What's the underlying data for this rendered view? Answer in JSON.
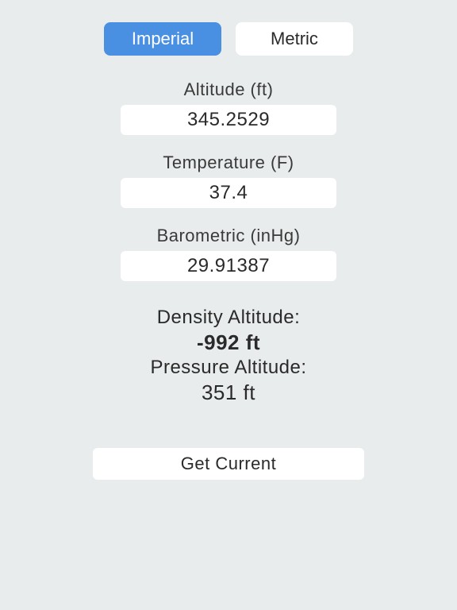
{
  "tabs": {
    "imperial": "Imperial",
    "metric": "Metric"
  },
  "fields": {
    "altitude": {
      "label": "Altitude (ft)",
      "value": "345.2529"
    },
    "temperature": {
      "label": "Temperature (F)",
      "value": "37.4"
    },
    "barometric": {
      "label": "Barometric (inHg)",
      "value": "29.91387"
    }
  },
  "results": {
    "density_label": "Density Altitude:",
    "density_value": "-992 ft",
    "pressure_label": "Pressure Altitude:",
    "pressure_value": "351 ft"
  },
  "actions": {
    "get_current": "Get Current"
  }
}
